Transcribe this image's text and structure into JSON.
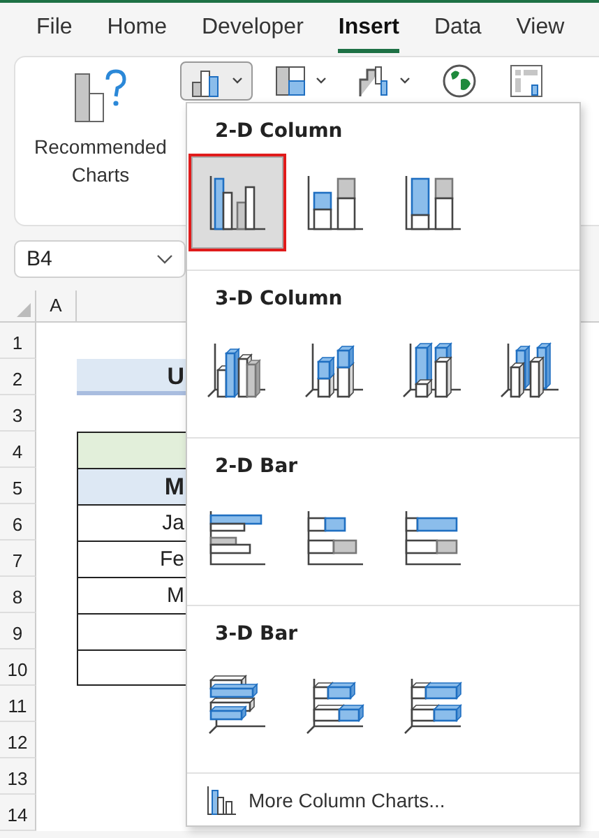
{
  "tabs": [
    {
      "label": "File",
      "selected": false
    },
    {
      "label": "Home",
      "selected": false
    },
    {
      "label": "Developer",
      "selected": false
    },
    {
      "label": "Insert",
      "selected": true
    },
    {
      "label": "Data",
      "selected": false
    },
    {
      "label": "View",
      "selected": false
    }
  ],
  "ribbon": {
    "recommended": {
      "label": "Recommended Charts"
    },
    "chart_buttons": [
      {
        "kind": "column",
        "pressed": true,
        "dropdown": true
      },
      {
        "kind": "hierarchy",
        "pressed": false,
        "dropdown": true
      },
      {
        "kind": "waterfall",
        "pressed": false,
        "dropdown": true
      },
      {
        "kind": "map",
        "pressed": false,
        "dropdown": false
      },
      {
        "kind": "pivot",
        "pressed": false,
        "dropdown": false
      }
    ]
  },
  "name_box": {
    "value": "B4"
  },
  "sheet": {
    "column_headers": [
      "A"
    ],
    "rows": [
      {
        "header": "1",
        "kind": "blank"
      },
      {
        "header": "2",
        "kind": "title",
        "text": "U"
      },
      {
        "header": "3",
        "kind": "blank"
      },
      {
        "header": "4",
        "kind": "table-top"
      },
      {
        "header": "5",
        "kind": "table-head",
        "text": "M"
      },
      {
        "header": "6",
        "kind": "table-body",
        "text": "Ja"
      },
      {
        "header": "7",
        "kind": "table-body",
        "text": "Fe"
      },
      {
        "header": "8",
        "kind": "table-body",
        "text": "M"
      },
      {
        "header": "9",
        "kind": "table-body"
      },
      {
        "header": "10",
        "kind": "table-body"
      },
      {
        "header": "11",
        "kind": "blank"
      },
      {
        "header": "12",
        "kind": "blank"
      },
      {
        "header": "13",
        "kind": "blank"
      },
      {
        "header": "14",
        "kind": "blank"
      }
    ]
  },
  "menu": {
    "sections": [
      {
        "title": "2-D Column",
        "items": [
          {
            "kind": "column-clustered",
            "selected": true
          },
          {
            "kind": "column-stacked",
            "selected": false
          },
          {
            "kind": "column-100",
            "selected": false
          }
        ]
      },
      {
        "title": "3-D Column",
        "items": [
          {
            "kind": "col3d-clustered",
            "selected": false
          },
          {
            "kind": "col3d-stacked",
            "selected": false
          },
          {
            "kind": "col3d-100",
            "selected": false
          },
          {
            "kind": "col3d",
            "selected": false
          }
        ]
      },
      {
        "title": "2-D Bar",
        "items": [
          {
            "kind": "bar-clustered",
            "selected": false
          },
          {
            "kind": "bar-stacked",
            "selected": false
          },
          {
            "kind": "bar-100",
            "selected": false
          }
        ]
      },
      {
        "title": "3-D Bar",
        "items": [
          {
            "kind": "bar3d-clustered",
            "selected": false
          },
          {
            "kind": "bar3d-stacked",
            "selected": false
          },
          {
            "kind": "bar3d-100",
            "selected": false
          }
        ]
      }
    ],
    "more": {
      "label": "More Column Charts..."
    }
  }
}
